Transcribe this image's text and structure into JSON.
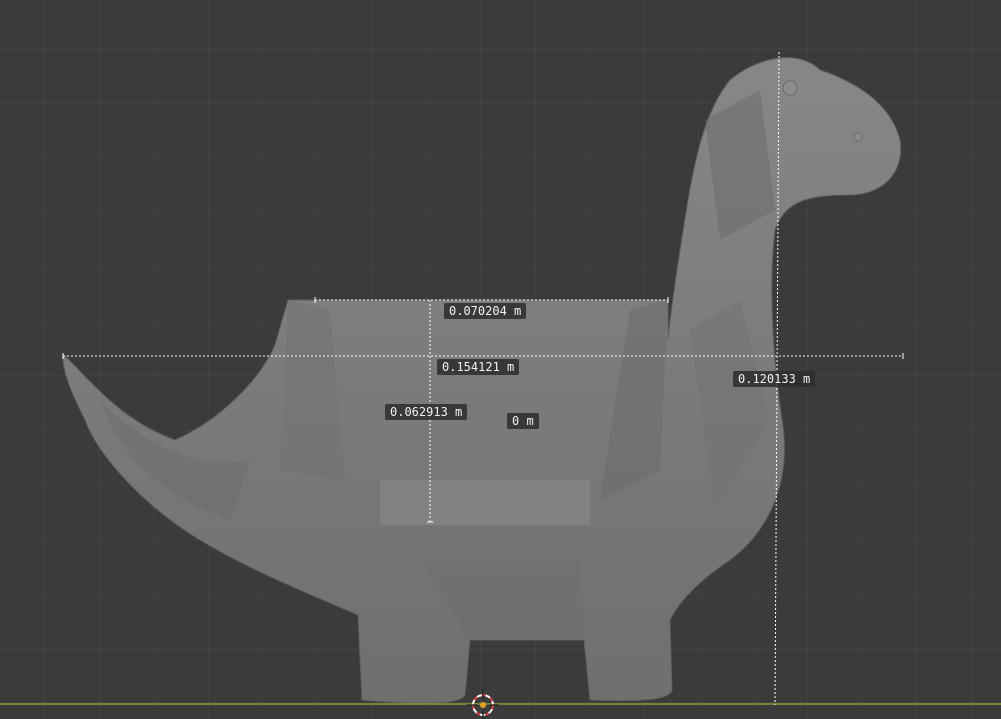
{
  "viewport": {
    "background": "#3b3b3b",
    "grid_color": "#4a4a4a",
    "ground_axis_color": "#8a9a3a"
  },
  "model": {
    "name": "dinosaur-planter",
    "color": "#7e7e7e"
  },
  "measurements": {
    "pot_width": "0.070204 m",
    "body_length": "0.154121 m",
    "neck_height": "0.120133 m",
    "pot_depth": "0.062913 m",
    "zero": "0 m"
  },
  "cursor": {
    "icon": "3d-cursor-icon"
  }
}
